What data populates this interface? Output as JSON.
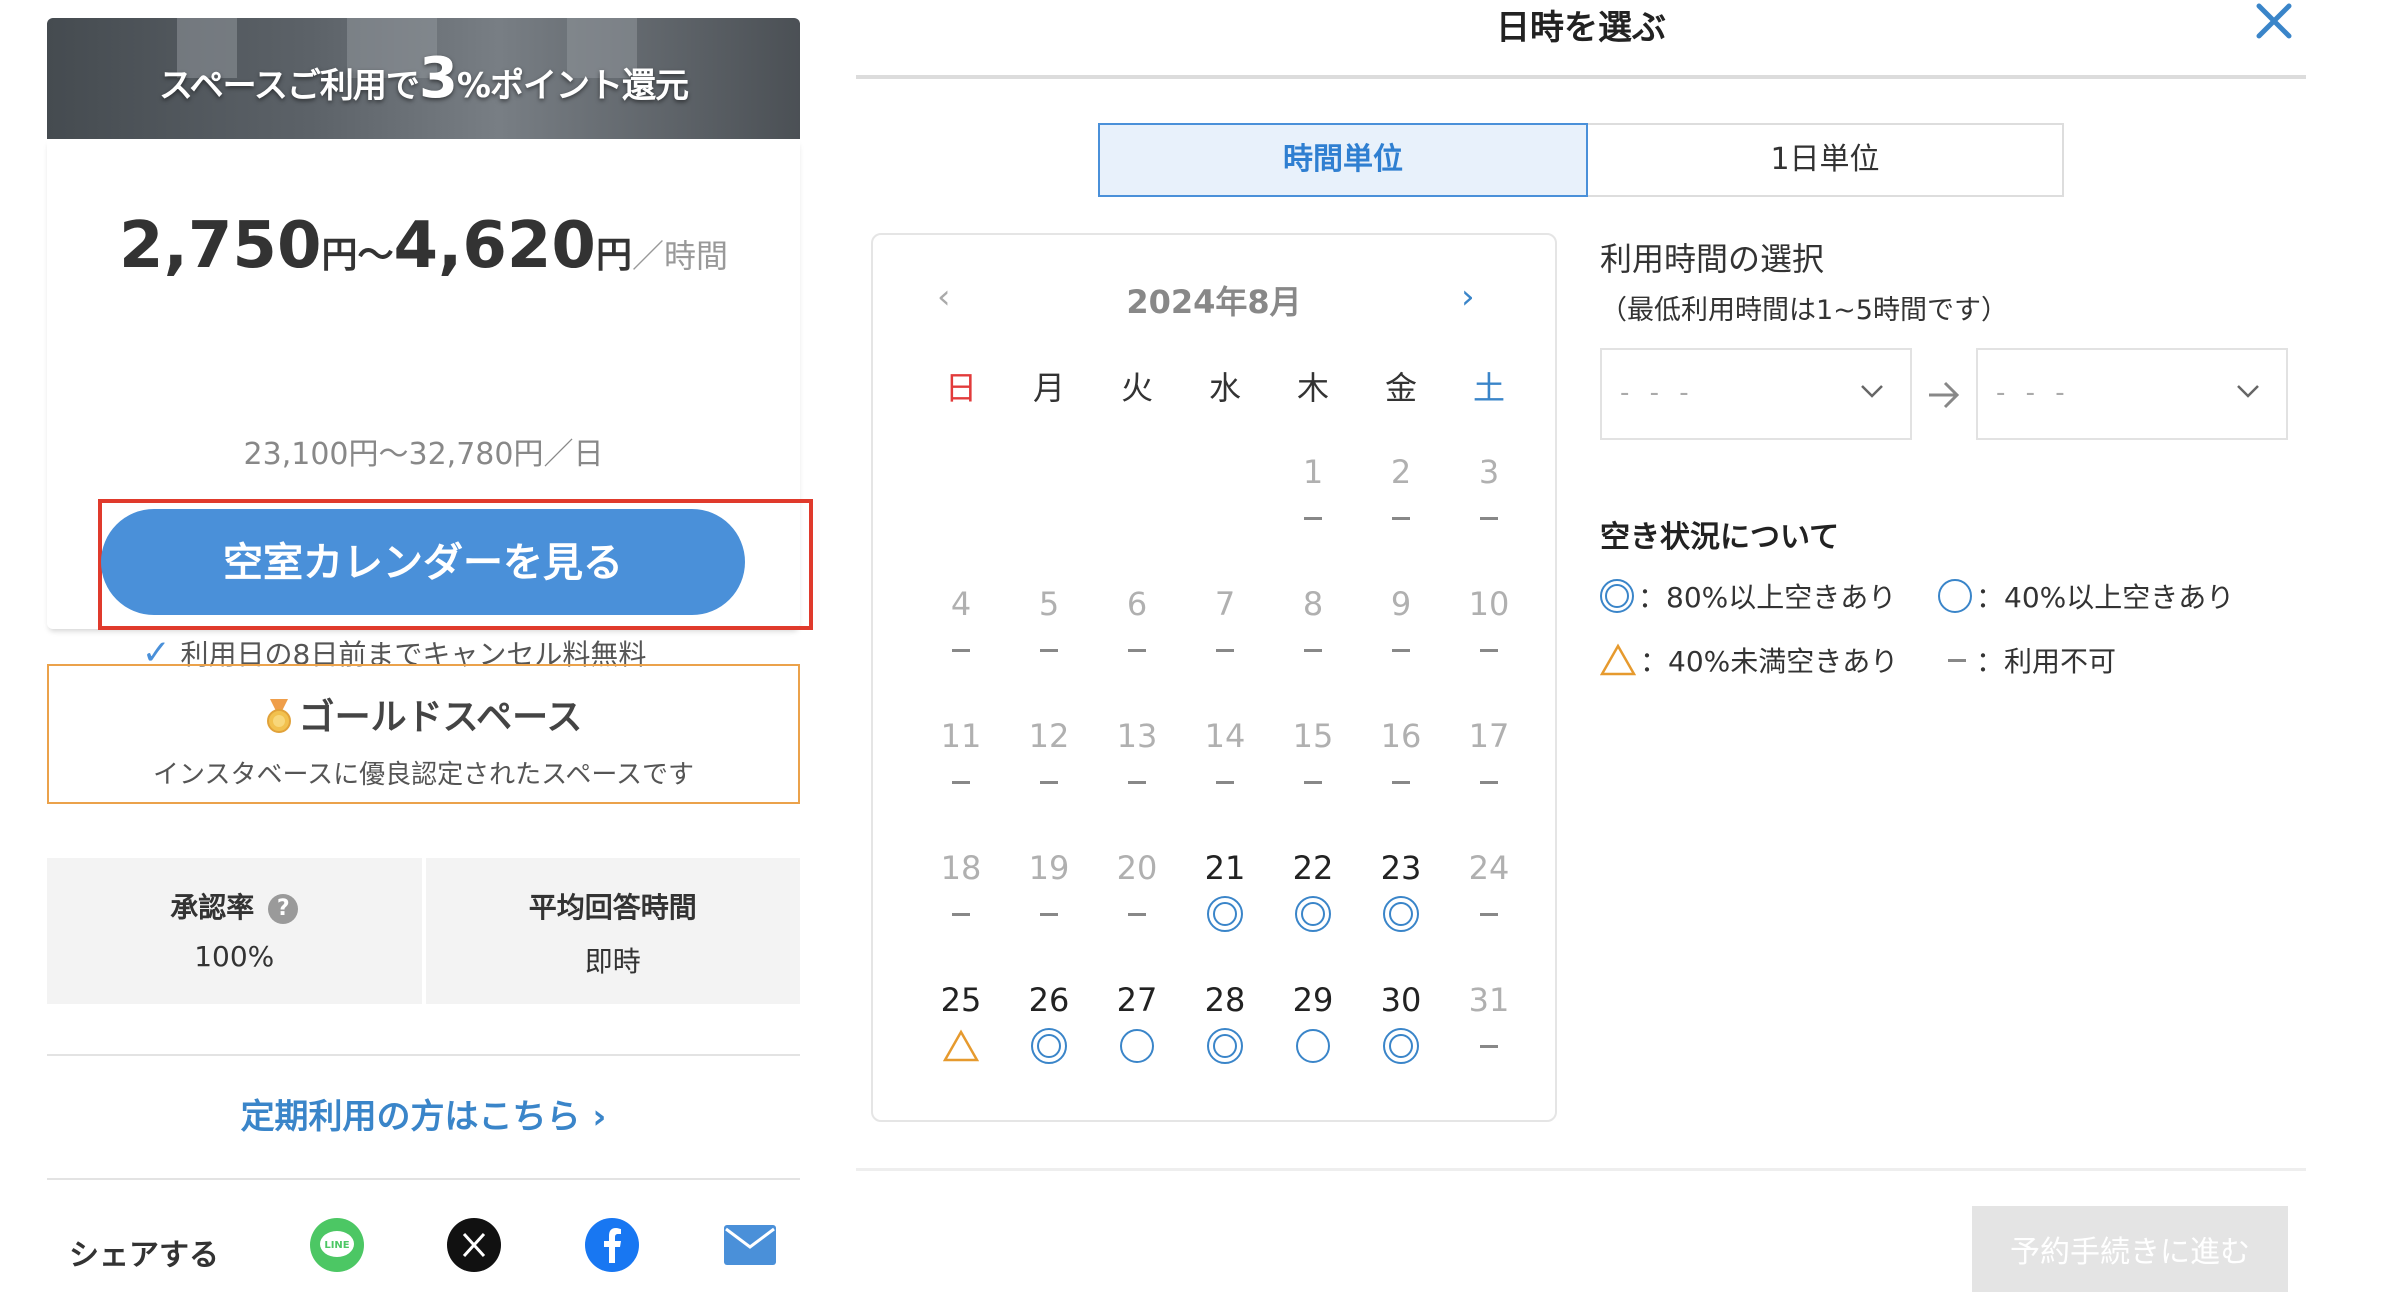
{
  "banner": {
    "prefix": "スペースご利用で",
    "highlight": "3",
    "suffix": "%ポイント還元"
  },
  "price": {
    "min": "2,750",
    "max": "4,620",
    "yen": "円",
    "tilde": "〜",
    "unit": "／時間",
    "day_range": "23,100円〜32,780円／日"
  },
  "calendar_button": {
    "label": "空室カレンダーを見る"
  },
  "cancel_note": "利用日の8日前までキャンセル料無料",
  "gold": {
    "title": "ゴールドスペース",
    "subtitle": "インスタベースに優良認定されたスペースです"
  },
  "stats": {
    "approval_label": "承認率",
    "approval_value": "100%",
    "response_label": "平均回答時間",
    "response_value": "即時"
  },
  "teiki_link": "定期利用の方はこちら",
  "share": {
    "label": "シェアする",
    "icons": [
      "line-icon",
      "x-icon",
      "facebook-icon",
      "mail-icon"
    ]
  },
  "dialog": {
    "title": "日時を選ぶ"
  },
  "tabs": [
    {
      "label": "時間単位",
      "active": true
    },
    {
      "label": "1日単位",
      "active": false
    }
  ],
  "calendar": {
    "month": "2024年8月",
    "weekdays": [
      "日",
      "月",
      "火",
      "水",
      "木",
      "金",
      "土"
    ],
    "days": [
      {
        "d": "1",
        "s": "none"
      },
      {
        "d": "2",
        "s": "none"
      },
      {
        "d": "3",
        "s": "none"
      },
      {
        "d": "4",
        "s": "none"
      },
      {
        "d": "5",
        "s": "none"
      },
      {
        "d": "6",
        "s": "none"
      },
      {
        "d": "7",
        "s": "none"
      },
      {
        "d": "8",
        "s": "none"
      },
      {
        "d": "9",
        "s": "none"
      },
      {
        "d": "10",
        "s": "none"
      },
      {
        "d": "11",
        "s": "none"
      },
      {
        "d": "12",
        "s": "none"
      },
      {
        "d": "13",
        "s": "none"
      },
      {
        "d": "14",
        "s": "none"
      },
      {
        "d": "15",
        "s": "none"
      },
      {
        "d": "16",
        "s": "none"
      },
      {
        "d": "17",
        "s": "none"
      },
      {
        "d": "18",
        "s": "none"
      },
      {
        "d": "19",
        "s": "none"
      },
      {
        "d": "20",
        "s": "none"
      },
      {
        "d": "21",
        "s": "double"
      },
      {
        "d": "22",
        "s": "double"
      },
      {
        "d": "23",
        "s": "double"
      },
      {
        "d": "24",
        "s": "none"
      },
      {
        "d": "25",
        "s": "triangle"
      },
      {
        "d": "26",
        "s": "double"
      },
      {
        "d": "27",
        "s": "circle"
      },
      {
        "d": "28",
        "s": "double"
      },
      {
        "d": "29",
        "s": "circle"
      },
      {
        "d": "30",
        "s": "double"
      },
      {
        "d": "31",
        "s": "none"
      }
    ]
  },
  "time_select": {
    "title": "利用時間の選択",
    "note": "（最低利用時間は1~5時間です）",
    "start_placeholder": "- - -",
    "end_placeholder": "- - -"
  },
  "legend": {
    "title": "空き状況について",
    "double": "：80%以上空きあり",
    "circle": "：40%以上空きあり",
    "triangle": "：40%未満空きあり",
    "none": "：利用不可"
  },
  "next_button": "予約手続きに進む",
  "colors": {
    "primary": "#4a90d9",
    "gold_border": "#eba24b",
    "triangle": "#e69a2e",
    "highlight_frame": "#e03a2c"
  }
}
